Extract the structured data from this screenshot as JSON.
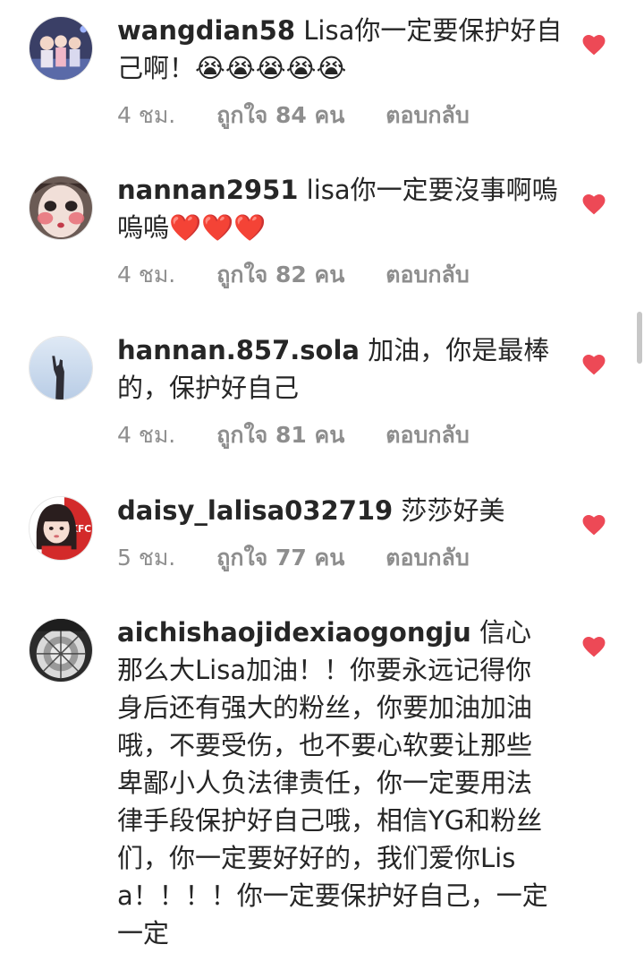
{
  "comments": [
    {
      "username": "wangdian58",
      "text": "Lisa你一定要保护好自己啊！😭😭😭😭😭",
      "time": "4 ชม.",
      "likes": "ถูกใจ 84 คน",
      "reply": "ตอบกลับ",
      "avatar": "concert-photo-avatar"
    },
    {
      "username": "nannan2951",
      "text": "lisa你一定要沒事啊嗚嗚嗚❤️❤️❤️",
      "time": "4 ชม.",
      "likes": "ถูกใจ 82 คน",
      "reply": "ตอบกลับ",
      "avatar": "face-avatar"
    },
    {
      "username": "hannan.857.sola",
      "text": "加油，你是最棒的，保护好自己",
      "time": "4 ชม.",
      "likes": "ถูกใจ 81 คน",
      "reply": "ตอบกลับ",
      "avatar": "sky-silhouette-avatar"
    },
    {
      "username": "daisy_lalisa032719",
      "text": "莎莎好美",
      "time": "5 ชม.",
      "likes": "ถูกใจ 77 คน",
      "reply": "ตอบกลับ",
      "avatar": "girl-kfc-avatar"
    },
    {
      "username": "aichishaojidexiaogongju",
      "text": "信心那么大Lisa加油！！你要永远记得你身后还有强大的粉丝，你要加油加油哦，不要受伤，也不要心软要让那些卑鄙小人负法律责任，你一定要用法律手段保护好自己哦，相信YG和粉丝们，你一定要好好的，我们爱你Lisa！！！！你一定要保护好自己，一定一定",
      "avatar": "dome-avatar"
    }
  ],
  "colors": {
    "heart": "#ed4956",
    "meta": "#8e8e8e",
    "text": "#262626"
  }
}
